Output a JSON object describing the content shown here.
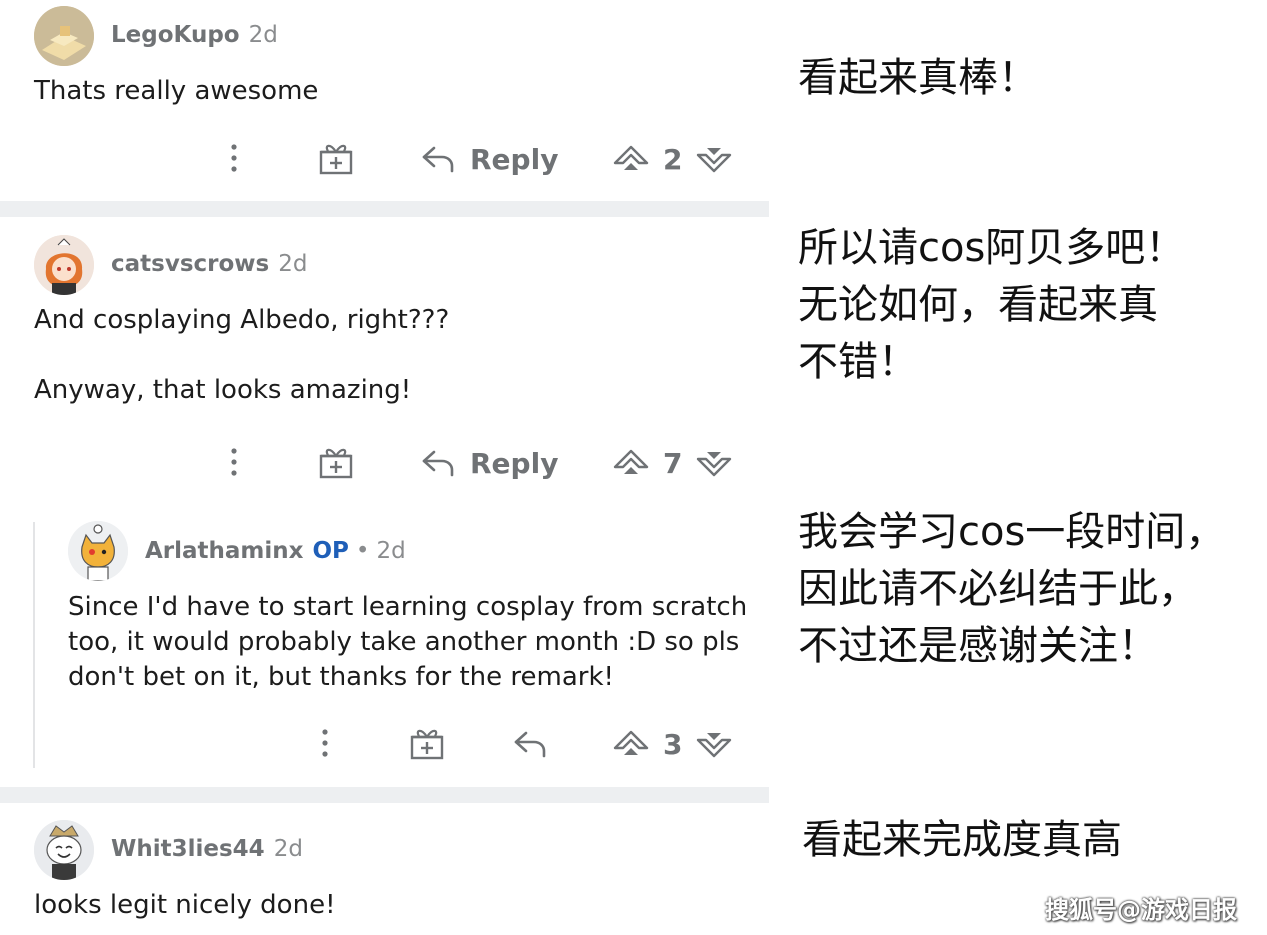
{
  "comments": [
    {
      "user": "LegoKupo",
      "time": "2d",
      "body": "Thats really awesome",
      "reply_label": "Reply",
      "score": "2"
    },
    {
      "user": "catsvscrows",
      "time": "2d",
      "body": "And cosplaying Albedo, right???\n\nAnyway, that looks amazing!",
      "reply_label": "Reply",
      "score": "7"
    },
    {
      "user": "Arlathaminx",
      "op_badge": "OP",
      "separator": "•",
      "time": "2d",
      "body": "Since I'd have to start learning cosplay from scratch\ntoo, it would probably take another month :D so pls\ndon't bet on it, but thanks for the remark!",
      "score": "3"
    },
    {
      "user": "Whit3lies44",
      "time": "2d",
      "body": "looks legit nicely done!"
    }
  ],
  "translations": [
    "看起来真棒！",
    "所以请cos阿贝多吧！\n无论如何，看起来真\n不错！",
    "我会学习cos一段时间，\n因此请不必纠结于此，\n不过还是感谢关注！",
    "看起来完成度真高"
  ],
  "watermark": "搜狐号@游戏日报",
  "icons": [
    "more-icon",
    "award-icon",
    "reply-icon",
    "upvote-icon",
    "downvote-icon"
  ],
  "colors": {
    "meta_gray": "#6f7275",
    "op_blue": "#1f5fb8",
    "separator_bg": "#edeff1"
  }
}
